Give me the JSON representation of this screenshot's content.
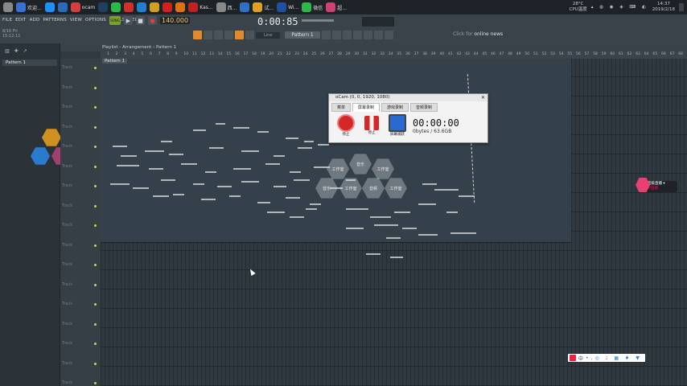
{
  "taskbar": {
    "apps": [
      {
        "label": "",
        "color": "#888888",
        "icon": "start-icon"
      },
      {
        "label": "欢迎...",
        "color": "#3a6fd6",
        "icon": "browser-icon"
      },
      {
        "label": "",
        "color": "#1e90ff",
        "icon": "explorer-icon"
      },
      {
        "label": "",
        "color": "#2a6ab8",
        "icon": "word-icon"
      },
      {
        "label": "ocam",
        "color": "#d04040",
        "icon": "ocam-icon"
      },
      {
        "label": "",
        "color": "#1f3f5f",
        "icon": "audition-icon"
      },
      {
        "label": "",
        "color": "#2db84a",
        "icon": "green-app-icon"
      },
      {
        "label": "",
        "color": "#d03030",
        "icon": "red-app-icon"
      },
      {
        "label": "",
        "color": "#2080d0",
        "icon": "chrome-icon"
      },
      {
        "label": "",
        "color": "#d0a020",
        "icon": "yellow-app-icon"
      },
      {
        "label": "",
        "color": "#d02020",
        "icon": "youku-icon"
      },
      {
        "label": "",
        "color": "#e07010",
        "icon": "firefox-icon"
      },
      {
        "label": "Kas...",
        "color": "#c02020",
        "icon": "kaspersky-icon"
      },
      {
        "label": "西...",
        "color": "#888888",
        "icon": "user-icon"
      },
      {
        "label": "",
        "color": "#3070c0",
        "icon": "blue-app-icon"
      },
      {
        "label": "试...",
        "color": "#e0a020",
        "icon": "fl-icon"
      },
      {
        "label": "Wi...",
        "color": "#2050a0",
        "icon": "word-doc-icon"
      },
      {
        "label": "微信",
        "color": "#2db84a",
        "icon": "wechat-icon"
      },
      {
        "label": "超...",
        "color": "#d04070",
        "icon": "pink-app-icon"
      }
    ],
    "tray": {
      "temp": "28°C",
      "cpu": "CPU温度",
      "time": "14:37",
      "date": "2019/2/18"
    }
  },
  "fl": {
    "menu": [
      "FILE",
      "EDIT",
      "ADD",
      "PATTERNS",
      "VIEW",
      "OPTIONS",
      "TOOLS",
      "HELP"
    ],
    "hint_lines": [
      "8/16 Fri",
      "15:12:11"
    ],
    "song_label": "SONG",
    "tempo": "140.000",
    "time_display": "0:00:85",
    "line_select": "Line",
    "pattern_select": "Pattern 1",
    "news_prefix": "Click for",
    "news_link": "online news"
  },
  "browser": {
    "item": "Pattern 1"
  },
  "playlist": {
    "title": "Playlist - Arrangement › Pattern 1",
    "pattern_label": "Pattern 1",
    "track_label": "Track",
    "ruler_numbers": [
      "1",
      "2",
      "3",
      "4",
      "5",
      "6",
      "7",
      "8",
      "9",
      "10",
      "11",
      "12",
      "13",
      "14",
      "15",
      "16",
      "17",
      "18",
      "19",
      "20",
      "21",
      "22",
      "23",
      "24",
      "25",
      "26",
      "27",
      "28",
      "29",
      "30",
      "31",
      "32",
      "33",
      "34",
      "35",
      "36",
      "37",
      "38",
      "39",
      "40",
      "41",
      "42",
      "43",
      "44",
      "45",
      "46",
      "47",
      "48",
      "49",
      "50",
      "51",
      "52",
      "53",
      "54",
      "55",
      "56",
      "57",
      "58",
      "59",
      "60",
      "61",
      "62",
      "63",
      "64",
      "65",
      "66",
      "67",
      "68"
    ]
  },
  "ocam": {
    "title": "oCam (0, 0, 1920, 1080)",
    "tabs": [
      "菜单",
      "屏幕录制",
      "游戏录制",
      "音频录制"
    ],
    "active_tab": 1,
    "buttons": [
      "停止",
      "停止",
      "屏幕捕获"
    ],
    "timer": "00:00:00",
    "size": "0bytes / 63.6GB"
  },
  "hex_overlay": [
    "工作室",
    "音乐",
    "工作室",
    "音乐",
    "工作室",
    "音频",
    "工作室"
  ],
  "right_widget": {
    "line1": "超级直播 ▾",
    "line2": "IP直播"
  },
  "ime": {
    "label": "中"
  }
}
